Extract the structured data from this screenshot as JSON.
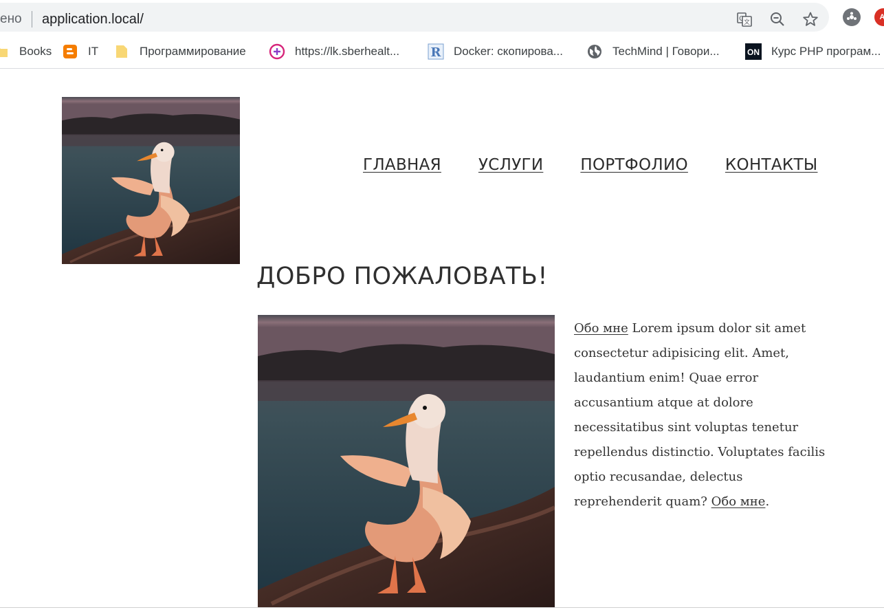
{
  "browser": {
    "omnibox_left_text": "ено",
    "url": "application.local/",
    "icons": [
      "translate-icon",
      "zoom-out-icon",
      "star-icon",
      "extension-icon",
      "profile-avatar-icon"
    ]
  },
  "bookmarks": [
    {
      "label": "Books",
      "icon": "folder-icon"
    },
    {
      "label": "IT",
      "icon": "blogger-icon"
    },
    {
      "label": "Программирование",
      "icon": "folder-icon"
    },
    {
      "label": "https://lk.sberhealt...",
      "icon": "plus-circle-icon"
    },
    {
      "label": "Docker: скопирова...",
      "icon": "r-icon"
    },
    {
      "label": "TechMind | Говори...",
      "icon": "globe-icon"
    },
    {
      "label": "Курс PHP програм...",
      "icon": "on-icon"
    }
  ],
  "nav": {
    "home": "ГЛАВНАЯ",
    "services": "УСЛУГИ",
    "portfolio": "ПОРТФОЛИО",
    "contacts": "КОНТАКТЫ"
  },
  "page": {
    "welcome": "ДОБРО ПОЖАЛОВАТЬ!",
    "about_link_1": "Обо мне",
    "about_text": " Lorem ipsum dolor sit amet consectetur adipisicing elit. Amet, laudantium enim! Quae error accusantium atque at dolore necessitatibus sint voluptas tenetur repellendus distinctio. Voluptates facilis optio recusandae, delectus reprehenderit quam? ",
    "about_link_2": "Обо мне",
    "about_end": "."
  },
  "colors": {
    "omnibox_bg": "#f1f3f4",
    "text_dark": "#2b2b2b",
    "blogger_orange": "#f57d00",
    "folder_yellow": "#f8d775"
  }
}
